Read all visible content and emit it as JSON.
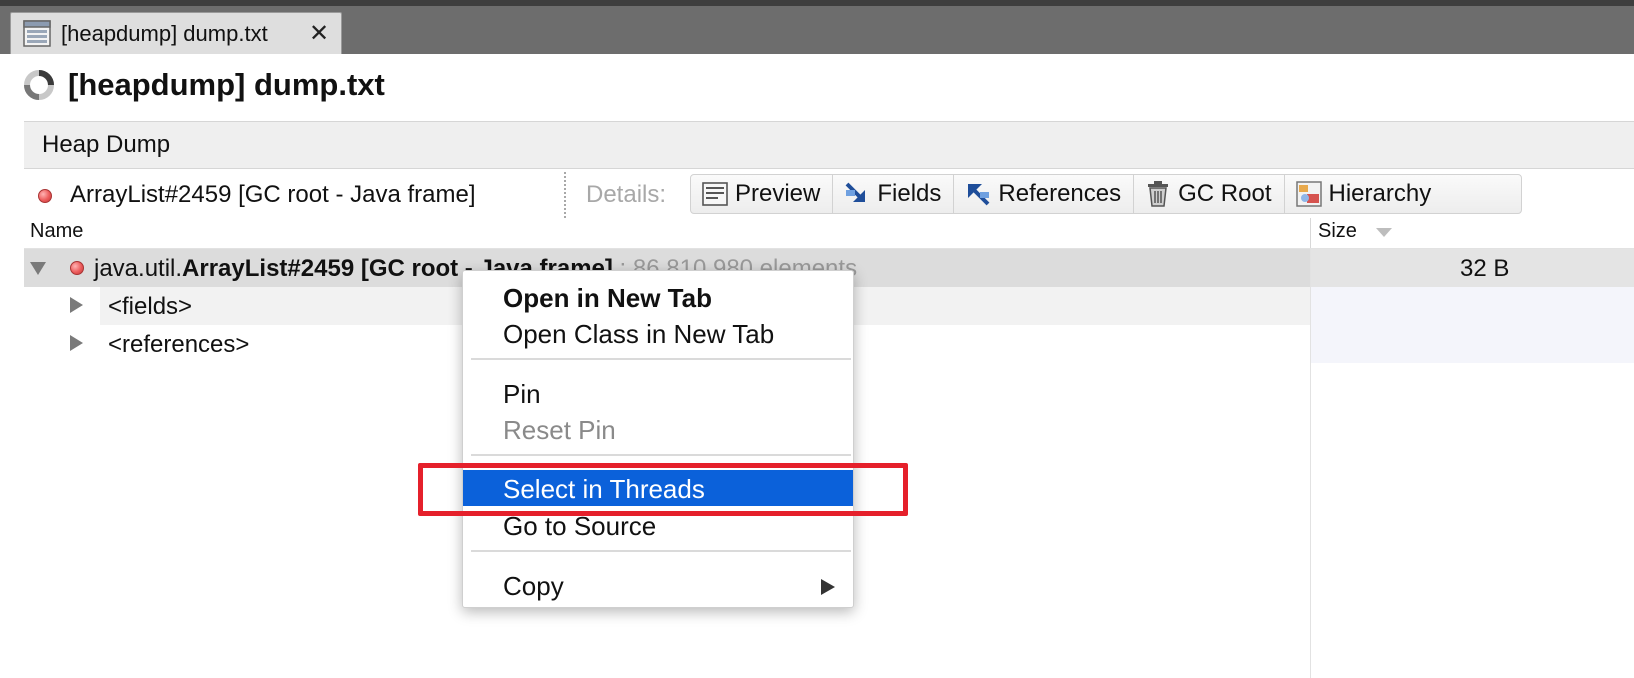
{
  "window_tab": {
    "title": "[heapdump] dump.txt",
    "close_glyph": "✕"
  },
  "page": {
    "title": "[heapdump] dump.txt"
  },
  "section": {
    "label": "Heap Dump"
  },
  "details_bar": {
    "selected_object": "ArrayList#2459 [GC root - Java frame]",
    "details_label": "Details:",
    "views": [
      {
        "label": "Preview",
        "icon": "preview-icon"
      },
      {
        "label": "Fields",
        "icon": "fields-icon"
      },
      {
        "label": "References",
        "icon": "references-icon"
      },
      {
        "label": "GC Root",
        "icon": "gc-root-icon"
      },
      {
        "label": "Hierarchy",
        "icon": "hierarchy-icon"
      }
    ]
  },
  "table": {
    "columns": {
      "name": "Name",
      "size": "Size"
    },
    "rows": [
      {
        "prefix": "java.util.",
        "class_name": "ArrayList#2459 [GC root - Java frame]",
        "suffix": " : 86,810,980 elements",
        "size": "32 B"
      },
      {
        "label": "<fields>"
      },
      {
        "label": "<references>"
      }
    ]
  },
  "context_menu": {
    "items": [
      {
        "label": "Open in New Tab"
      },
      {
        "label": "Open Class in New Tab"
      },
      {
        "label": "Pin"
      },
      {
        "label": "Reset Pin"
      },
      {
        "label": "Select in Threads"
      },
      {
        "label": "Go to Source"
      },
      {
        "label": "Copy"
      }
    ]
  },
  "colors": {
    "menu_highlight": "#0b61da",
    "annotation": "#e5202b",
    "gc_root_dot": "#ec5b5b",
    "tabbar": "#6d6d6d"
  }
}
